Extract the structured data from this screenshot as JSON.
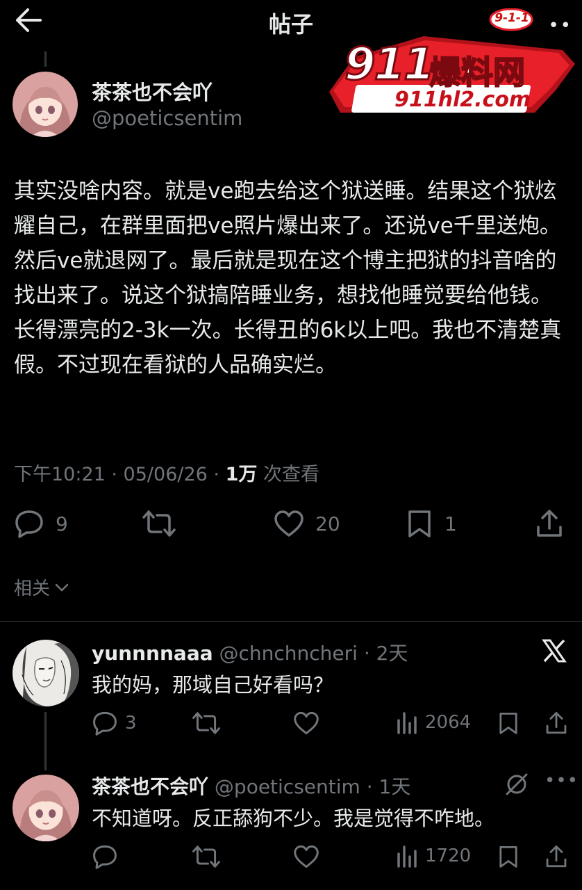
{
  "header": {
    "title": "帖子"
  },
  "watermark": {
    "badge": "9-1-1",
    "brand_num": "911",
    "brand_name": "爆料网",
    "domain": "911hl2.com"
  },
  "post": {
    "author_name": "茶茶也不会吖",
    "author_handle": "@poeticsentim",
    "body": "其实没啥内容。就是ve跑去给这个狱送睡。结果这个狱炫耀自己，在群里面把ve照片爆出来了。还说ve千里送炮。然后ve就退网了。最后就是现在这个博主把狱的抖音啥的找出来了。说这个狱搞陪睡业务，想找他睡觉要给他钱。长得漂亮的2-3k一次。长得丑的6k以上吧。我也不清楚真假。不过现在看狱的人品确实烂。",
    "time": "下午10:21 · 05/06/26 · ",
    "views": "1万",
    "views_label": " 次查看",
    "replies": "9",
    "likes": "20",
    "bookmarks": "1"
  },
  "related_label": "相关",
  "replies": [
    {
      "name": "yunnnnaaa",
      "handle": "@chnchncheri",
      "age": " · 2天",
      "text": "我的妈，那域自己好看吗？",
      "replies": "3",
      "views": "2064"
    },
    {
      "name": "茶茶也不会吖",
      "handle": "@poeticsentim",
      "age": " · 1天",
      "text": "不知道呀。反正舔狗不少。我是觉得不咋地。",
      "views": "1720"
    }
  ],
  "colors": {
    "background": "#000000",
    "text": "#e7e9ea",
    "muted": "#71767b",
    "watermark_red": "#e8202a"
  }
}
